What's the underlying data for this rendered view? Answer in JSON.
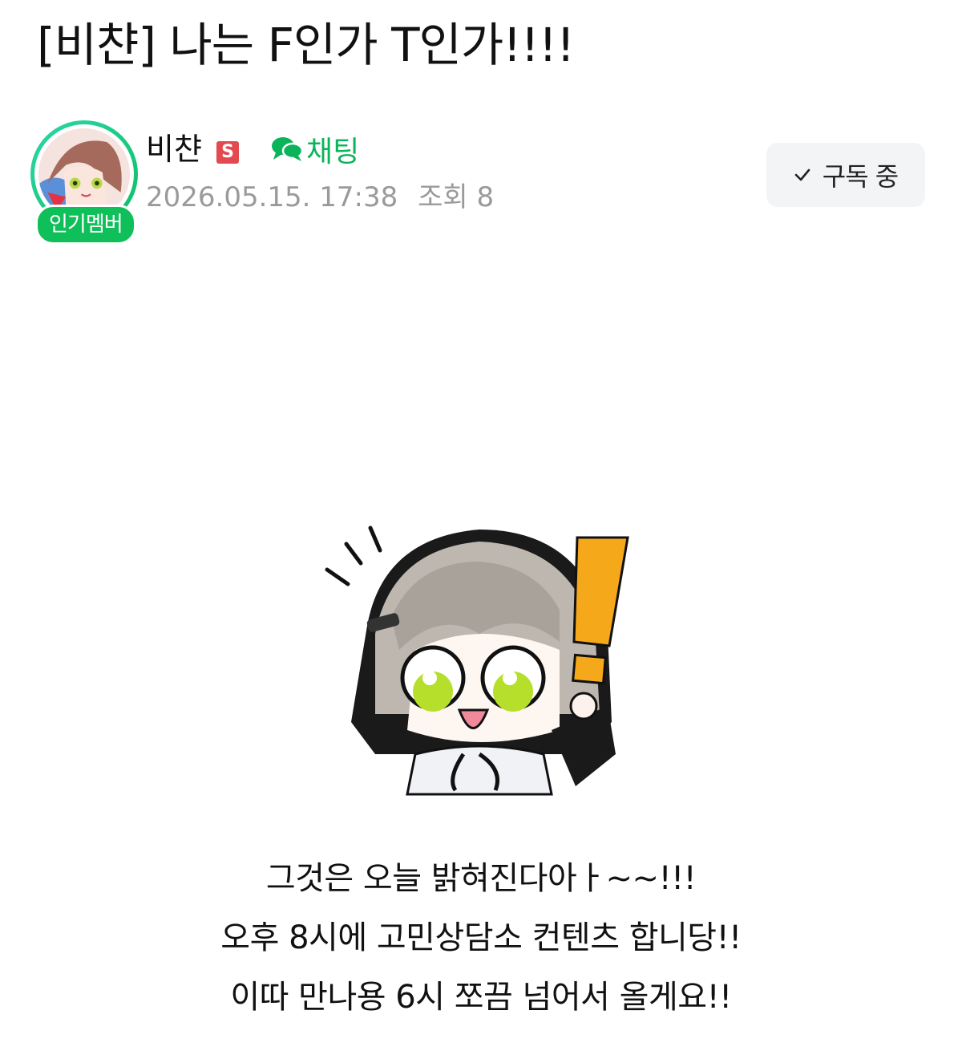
{
  "post": {
    "title": "[비챤] 나는 F인가 T인가!!!!",
    "body_lines": [
      "그것은 오늘 밝혀진다아ㅏ~~!!!",
      "오후 8시에 고민상담소 컨텐츠 합니당!!",
      "이따 만나용 6시 쪼끔 넘어서 올게요!!"
    ]
  },
  "author": {
    "name": "비챤",
    "staff_badge": "S",
    "member_badge": "인기멤버",
    "chat_label": "채팅",
    "date": "2026.05.15. 17:38",
    "views": "조회 8"
  },
  "subscribe": {
    "label": "구독 중"
  },
  "colors": {
    "accent_green": "#0bb35a",
    "badge_green": "#0fbf5a",
    "staff_red": "#e24a4f",
    "meta_gray": "#9a9a9a",
    "button_bg": "#f3f4f5"
  },
  "icons": {
    "chat": "chat-bubbles-icon",
    "check": "check-icon"
  }
}
